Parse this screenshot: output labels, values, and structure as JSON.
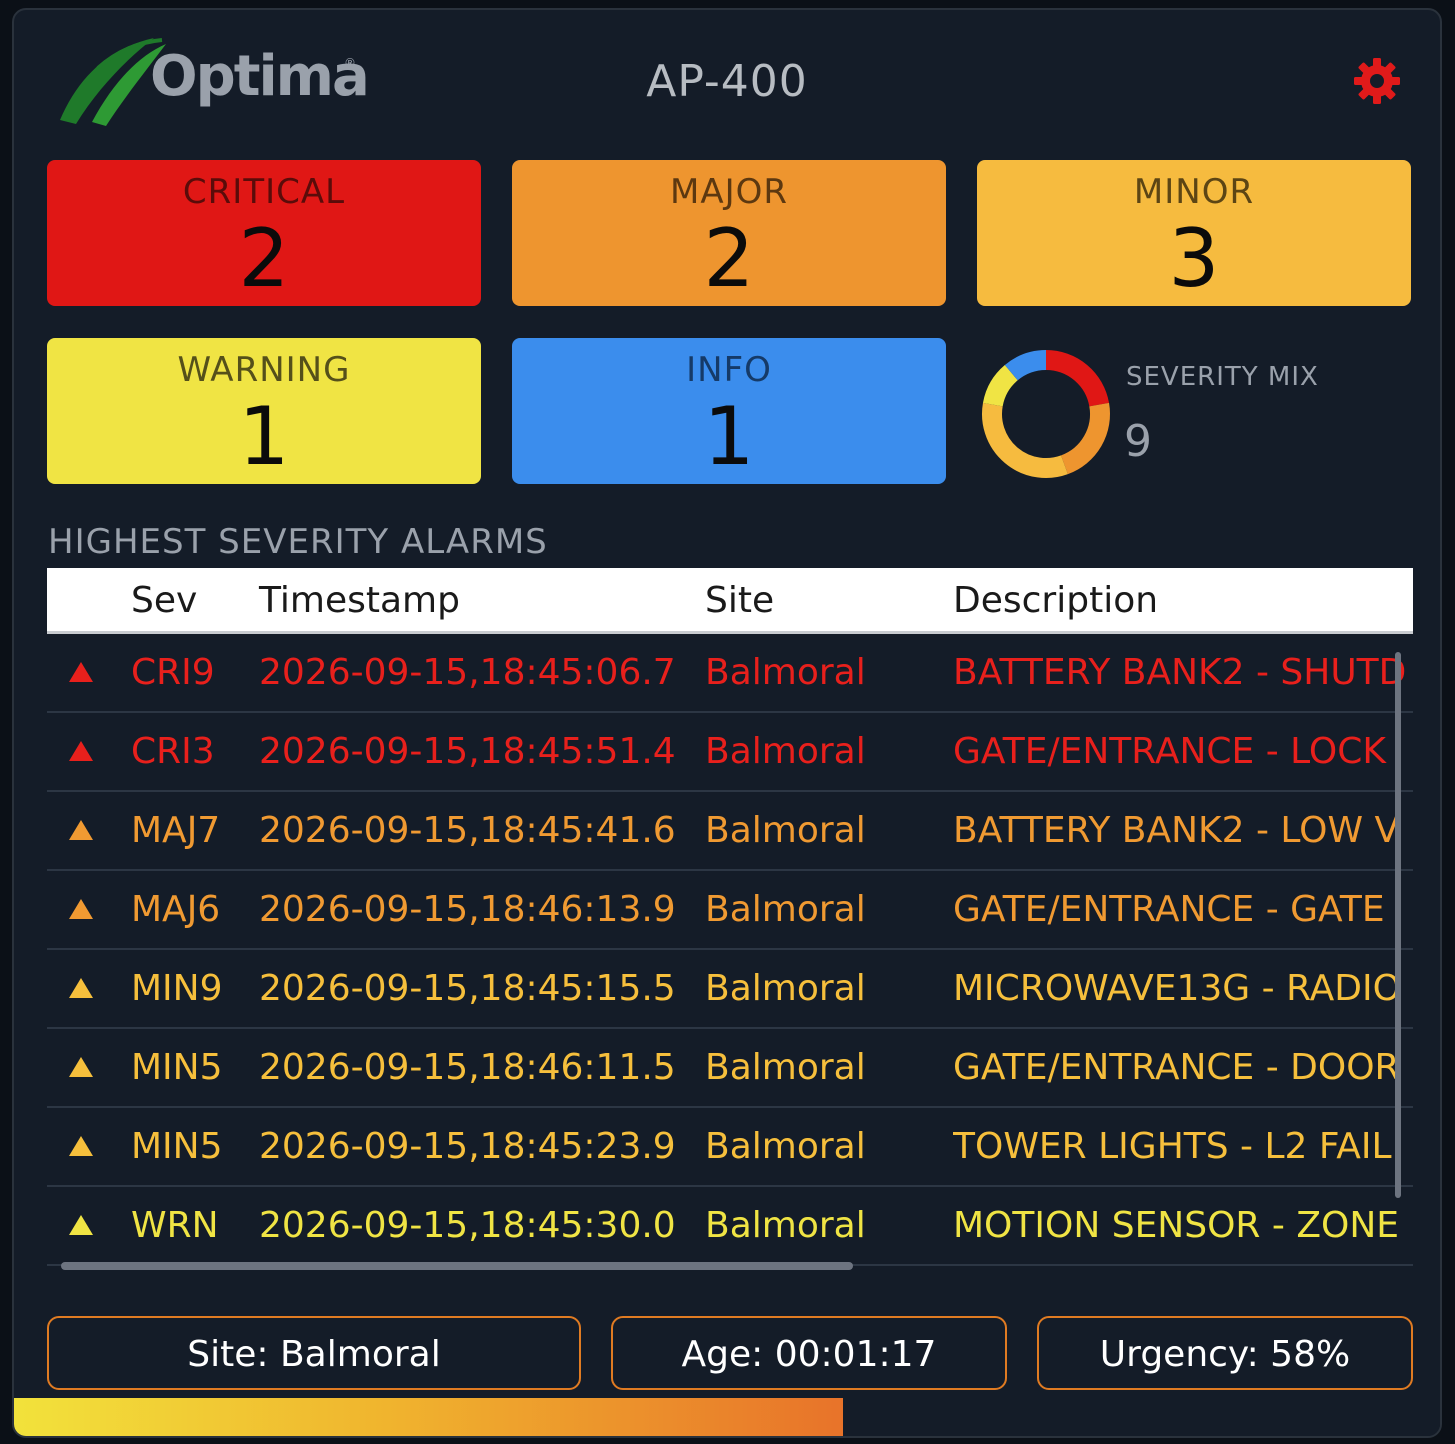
{
  "header": {
    "logo_text": "Optima",
    "logo_reg": "®",
    "title": "AP-400",
    "settings_icon": "gear-icon",
    "settings_color": "#e01a1a"
  },
  "summary_cards": [
    {
      "label": "CRITICAL",
      "count": "2",
      "color": "#e01715"
    },
    {
      "label": "MAJOR",
      "count": "2",
      "color": "#ee952f"
    },
    {
      "label": "MINOR",
      "count": "3",
      "color": "#f6bb3f"
    },
    {
      "label": "WARNING",
      "count": "1",
      "color": "#f0e444"
    },
    {
      "label": "INFO",
      "count": "1",
      "color": "#3b8ded"
    }
  ],
  "severity_mix": {
    "label": "SEVERITY MIX",
    "total": "9",
    "segments": [
      {
        "severity": "CRITICAL",
        "count": 2,
        "color": "#e01715"
      },
      {
        "severity": "MAJOR",
        "count": 2,
        "color": "#ee952f"
      },
      {
        "severity": "MINOR",
        "count": 3,
        "color": "#f6bb3f"
      },
      {
        "severity": "WARNING",
        "count": 1,
        "color": "#f0e444"
      },
      {
        "severity": "INFO",
        "count": 1,
        "color": "#3b8ded"
      }
    ]
  },
  "alarms": {
    "section_title": "HIGHEST SEVERITY ALARMS",
    "columns": [
      "Sev",
      "Timestamp",
      "Site",
      "Description"
    ],
    "rows": [
      {
        "sev": "CRI9",
        "timestamp": "2026-09-15,18:45:06.7",
        "site": "Balmoral",
        "description": "BATTERY BANK2 - SHUTD",
        "color": "#e8201c"
      },
      {
        "sev": "CRI3",
        "timestamp": "2026-09-15,18:45:51.4",
        "site": "Balmoral",
        "description": "GATE/ENTRANCE - LOCK",
        "color": "#e8201c"
      },
      {
        "sev": "MAJ7",
        "timestamp": "2026-09-15,18:45:41.6",
        "site": "Balmoral",
        "description": "BATTERY BANK2 - LOW V",
        "color": "#f09a32"
      },
      {
        "sev": "MAJ6",
        "timestamp": "2026-09-15,18:46:13.9",
        "site": "Balmoral",
        "description": "GATE/ENTRANCE - GATE",
        "color": "#f09a32"
      },
      {
        "sev": "MIN9",
        "timestamp": "2026-09-15,18:45:15.5",
        "site": "Balmoral",
        "description": "MICROWAVE13G  - RADIO",
        "color": "#f6bf3c"
      },
      {
        "sev": "MIN5",
        "timestamp": "2026-09-15,18:46:11.5",
        "site": "Balmoral",
        "description": "GATE/ENTRANCE - DOOR",
        "color": "#f6bf3c"
      },
      {
        "sev": "MIN5",
        "timestamp": "2026-09-15,18:45:23.9",
        "site": "Balmoral",
        "description": "TOWER LIGHTS  - L2 FAIL",
        "color": "#f6bf3c"
      },
      {
        "sev": "WRN",
        "timestamp": "2026-09-15,18:45:30.0",
        "site": "Balmoral",
        "description": "MOTION SENSOR - ZONE",
        "color": "#f0e444"
      }
    ]
  },
  "footer": {
    "site_button": "Site: Balmoral",
    "age_button": "Age: 00:01:17",
    "urgency_button": "Urgency: 58%",
    "urgency_fraction": 0.58,
    "border_color": "#e07b22"
  }
}
